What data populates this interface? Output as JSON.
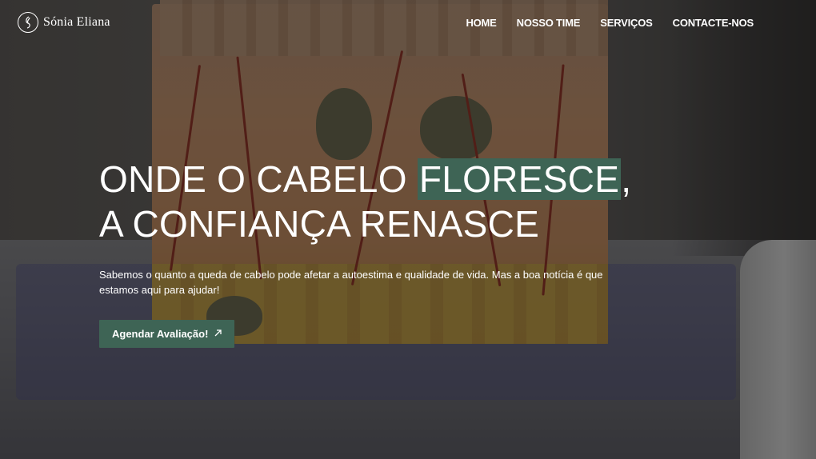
{
  "brand": {
    "name": "Sónia Eliana"
  },
  "nav": {
    "items": [
      {
        "label": "HOME"
      },
      {
        "label": "NOSSO TIME"
      },
      {
        "label": "SERVIÇOS"
      },
      {
        "label": "CONTACTE-NOS"
      }
    ]
  },
  "hero": {
    "title_line1_pre": "ONDE O CABELO ",
    "title_highlight": "FLORESCE",
    "title_line1_post": ",",
    "title_line2": "A CONFIANÇA RENASCE",
    "description": "Sabemos o quanto a queda de cabelo pode afetar a autoestima e qualidade de vida. Mas a boa notícia é que estamos aqui para ajudar!",
    "cta_label": "Agendar Avaliação!",
    "cta_icon": "arrow-up-right-icon"
  },
  "colors": {
    "accent": "#3e6455",
    "text": "#ffffff",
    "overlay": "#141414"
  }
}
